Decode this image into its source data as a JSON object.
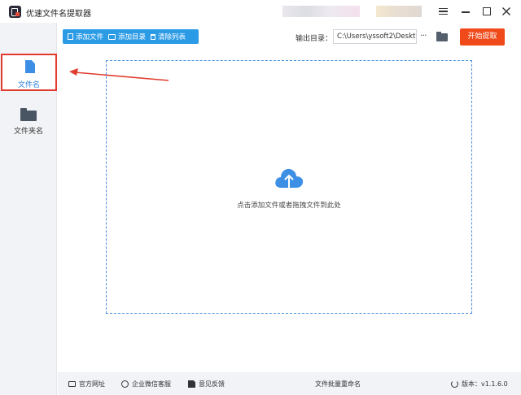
{
  "window": {
    "title": "优速文件名提取器"
  },
  "sidebar": {
    "items": [
      {
        "label": "文件名"
      },
      {
        "label": "文件夹名"
      }
    ]
  },
  "toolbar": {
    "add_file": "添加文件",
    "add_folder": "添加目录",
    "clear_list": "清除列表"
  },
  "output": {
    "label": "输出目录：",
    "path": "C:\\Users\\yssoft2\\Deskt",
    "more": "···",
    "start_button": "开始提取"
  },
  "dropzone": {
    "hint": "点击添加文件或者拖拽文件到此处"
  },
  "footer": {
    "website": "官方网址",
    "wechat": "企业微信客服",
    "feedback": "意见反馈",
    "center": "文件批量重命名",
    "version": "版本：v1.1.6.0"
  },
  "colors": {
    "accent": "#2c9be6",
    "start": "#f04a1a",
    "highlight": "#e03b2d"
  }
}
